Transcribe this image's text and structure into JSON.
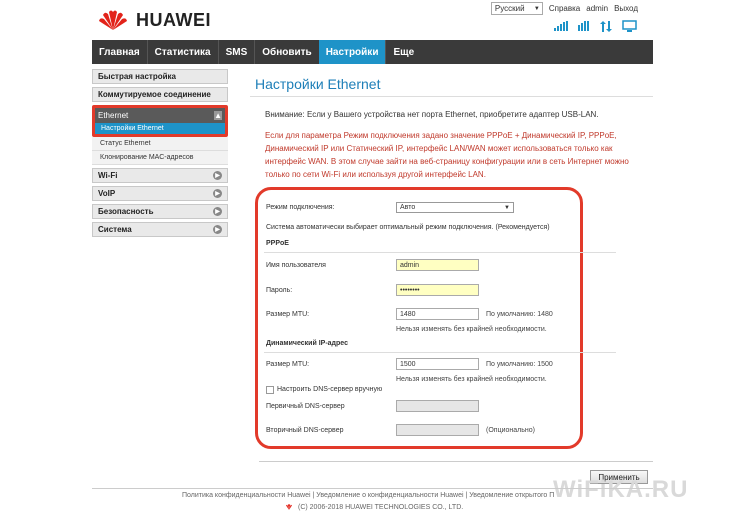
{
  "header": {
    "brand": "HUAWEI",
    "language": "Русский",
    "links": [
      "Справка",
      "admin",
      "Выход"
    ],
    "status_icons": [
      "signal-strength-icon",
      "network-4g-icon",
      "data-transfer-icon",
      "pc-connection-icon"
    ]
  },
  "nav": {
    "items": [
      {
        "label": "Главная",
        "active": false
      },
      {
        "label": "Статистика",
        "active": false
      },
      {
        "label": "SMS",
        "active": false
      },
      {
        "label": "Обновить",
        "active": false
      },
      {
        "label": "Настройки",
        "active": true
      },
      {
        "label": "Еще",
        "active": false
      }
    ]
  },
  "sidebar": {
    "quick_setup": "Быстрая настройка",
    "dialup": "Коммутируемое соединение",
    "ethernet": "Ethernet",
    "ethernet_sub": [
      "Настройки Ethernet",
      "Статус Ethernet",
      "Клонирование МАС-адресов"
    ],
    "wifi": "Wi-Fi",
    "voip": "VoIP",
    "security": "Безопасность",
    "system": "Система"
  },
  "main": {
    "title": "Настройки Ethernet",
    "notice": "Внимание: Если у Вашего устройства нет порта Ethernet, приобретите адаптер USB-LAN.",
    "warning": "Если для параметра Режим подключения задано значение PPPoE + Динамический IP, PPPoE, Динамический IP или Статический IP, интерфейс LAN/WAN может использоваться только как интерфейс WAN. В этом случае зайти на веб-страницу конфигурации или в сеть Интернет можно только по сети Wi-Fi или используя другой интерфейс LAN.",
    "form": {
      "mode_label": "Режим подключения:",
      "mode_value": "Авто",
      "auto_note": "Система автоматически выбирает оптимальный режим подключения. (Рекомендуется)",
      "pppoe_heading": "PPPoE",
      "username_label": "Имя пользователя",
      "username_value": "admin",
      "password_label": "Пароль:",
      "password_value": "••••••••",
      "mtu_label": "Размер MTU:",
      "pppoe_mtu_value": "1480",
      "pppoe_mtu_default": "По умолчанию: 1480",
      "no_change_note": "Нельзя изменять без крайней необходимости.",
      "dhcp_heading": "Динамический IP-адрес",
      "dhcp_mtu_value": "1500",
      "dhcp_mtu_default": "По умолчанию: 1500",
      "dns_manual_label": "Настроить DNS-сервер вручную",
      "primary_dns_label": "Первичный DNS-сервер",
      "secondary_dns_label": "Вторичный DNS-сервер",
      "optional_note": "(Опционально)"
    },
    "apply_label": "Применить"
  },
  "footer": {
    "links": "Политика конфиденциальности Huawei  |  Уведомление о конфиденциальности Huawei  |  Уведомление открытого П",
    "copyright": "(C) 2006-2018 HUAWEI TECHNOLOGIES CO., LTD.",
    "watermark": "WiFiKA.RU"
  },
  "colors": {
    "accent": "#1e93c8",
    "nav_bg": "#3a3a3a",
    "highlight": "#e23a2a",
    "warning_text": "#c0392b",
    "title": "#1e7fb8"
  }
}
